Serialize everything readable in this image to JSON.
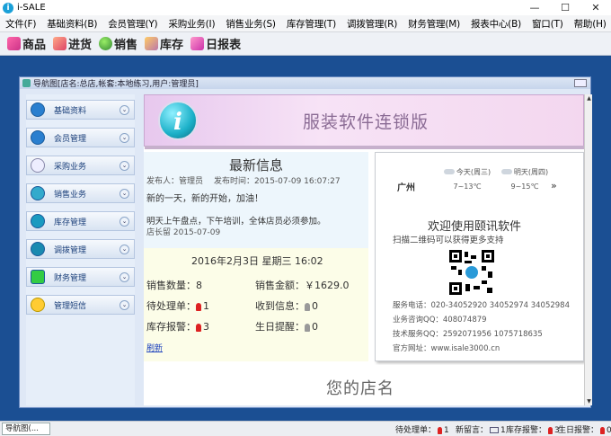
{
  "app": {
    "title": "i-SALE"
  },
  "menu": [
    "文件(F)",
    "基础资料(B)",
    "会员管理(Y)",
    "采购业务(I)",
    "销售业务(S)",
    "库存管理(T)",
    "调拨管理(R)",
    "财务管理(M)",
    "报表中心(B)",
    "窗口(T)",
    "帮助(H)"
  ],
  "toolbar": {
    "goods": "商品",
    "stock_in": "进货",
    "sales": "销售",
    "inventory": "库存",
    "daily_report": "日报表"
  },
  "window": {
    "title": "导航图[店名:总店,帐套:本地练习,用户:管理员]"
  },
  "nav": [
    "基础资料",
    "会员管理",
    "采购业务",
    "销售业务",
    "库存管理",
    "调拨管理",
    "财务管理",
    "管理短信"
  ],
  "banner": {
    "title": "服装软件连锁版"
  },
  "news": {
    "title": "最新信息",
    "publisher": "发布人：管理员",
    "publish_time": "发布时间：2015-07-09 16:07:27",
    "line1": "新的一天，新的开始，加油！",
    "line2": "明天上午盘点，下午培训，全体店员必须参加。",
    "line3": "店长留 2015-07-09"
  },
  "stats": {
    "datetime": "2016年2月3日  星期三 16:02",
    "sales_qty_label": "销售数量：",
    "sales_qty": "8",
    "sales_amount_label": "销售金额：",
    "sales_amount": "￥1629.0",
    "pending_label": "待处理单：",
    "pending": "1",
    "received_label": "收到信息：",
    "received": "0",
    "stock_alert_label": "库存报警：",
    "stock_alert": "3",
    "birthday_label": "生日提醒：",
    "birthday": "0",
    "refresh": "刷新"
  },
  "promo": {
    "city": "广州",
    "today": "今天(周三)",
    "today_temp": "7~13℃",
    "tomorrow": "明天(周四)",
    "tomorrow_temp": "9~15℃",
    "more": "»",
    "welcome": "欢迎使用�butt讯软件",
    "scan_tip": "扫描二维码可以获得更多支持",
    "service_phone": "服务电话：020-34052920  34052974  34052984",
    "business_qq": "业务咨询QQ：408074879",
    "tech_qq": "技术服务QQ：2592071956  1075718635",
    "website": "官方网址：www.isale3000.cn"
  },
  "store": {
    "name": "您的店名"
  },
  "statusbar": {
    "tab": "导航图(...",
    "pending": "待处理单：",
    "pending_val": "1",
    "new_msg": "新留言：",
    "new_msg_val": "1",
    "stock_alert": "库存报警：",
    "stock_alert_val": "3",
    "birthday": "生日报警：",
    "birthday_val": "0"
  },
  "colors": {
    "desktop": "#1b4f93",
    "banner_text": "#8a6b94",
    "refresh_link": "#1a3fbd"
  }
}
